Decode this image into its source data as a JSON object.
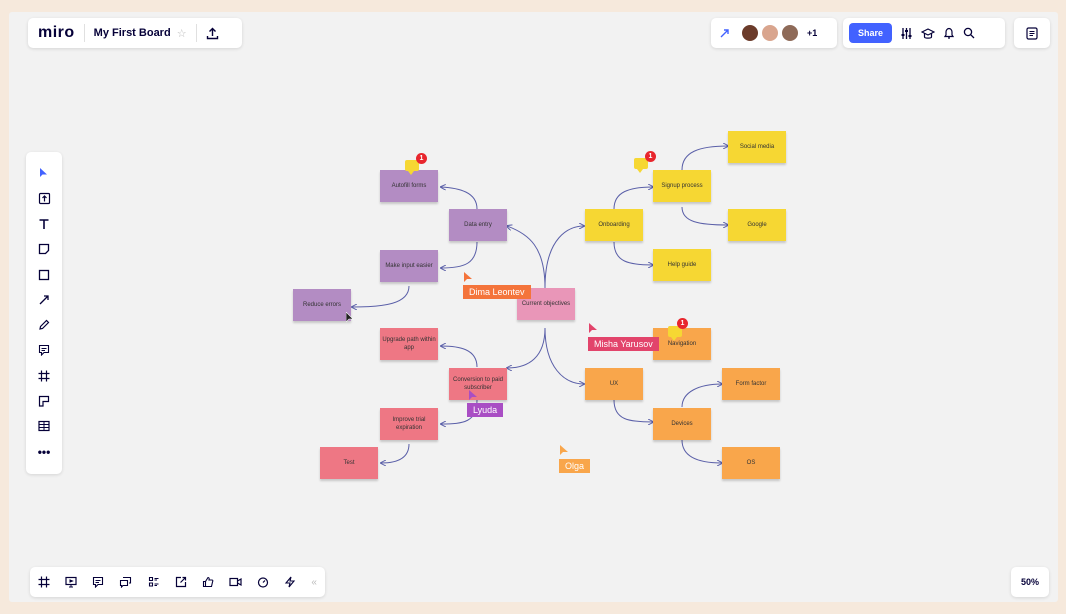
{
  "app": {
    "logo": "miro",
    "board_title": "My First Board"
  },
  "header": {
    "star_icon": "star-icon",
    "upload_icon": "upload-icon",
    "collaborators_extra": "+1",
    "share_label": "Share",
    "avatars": [
      "avatar-1",
      "avatar-2",
      "avatar-3"
    ]
  },
  "zoom_label": "50%",
  "left_toolbar": [
    "select-icon",
    "upload-icon",
    "text-icon",
    "sticky-note-icon",
    "shape-icon",
    "pen-line-icon",
    "pen-icon",
    "comment-icon",
    "frame-icon",
    "card-icon",
    "table-icon",
    "more-icon"
  ],
  "bottom_toolbar": [
    "frames-icon",
    "presentation-icon",
    "comments-icon",
    "chat-icon",
    "cards-icon",
    "share-screen-icon",
    "vote-icon",
    "video-icon",
    "timer-icon",
    "activity-icon",
    "collapse-icon"
  ],
  "mindmap": {
    "center": "Current objectives",
    "autofill": "Autofill forms",
    "data_entry": "Data entry",
    "make_input_easier": "Make input easier",
    "reduce_errors": "Reduce errors",
    "upgrade_path": "Upgrade path within app",
    "conversion": "Conversion to paid subscriber",
    "improve_trial": "Improve trial expiration",
    "test": "Test",
    "onboarding": "Onboarding",
    "signup": "Signup process",
    "social_media": "Social media",
    "google": "Google",
    "help_guide": "Help guide",
    "navigation": "Navigation",
    "ux": "UX",
    "form_factor": "Form factor",
    "devices": "Devices",
    "os": "OS"
  },
  "comment_badges": {
    "autofill": "1",
    "signup": "1",
    "navigation": "1"
  },
  "cursors": {
    "dima": "Dima Leontev",
    "misha": "Misha Yarusov",
    "lyuda": "Lyuda",
    "olga": "Olga"
  },
  "colors": {
    "accent": "#4262ff",
    "purple_note": "#b38cc3",
    "pink_note": "#e996b8",
    "rose_note": "#ee7784",
    "yellow_note": "#f6d733",
    "orange_note": "#f9a64b",
    "connector": "#5a5fa8",
    "dima_cursor": "#f4743b",
    "misha_cursor": "#e2446b",
    "lyuda_cursor": "#a94ec4",
    "olga_cursor": "#f9a64b"
  }
}
